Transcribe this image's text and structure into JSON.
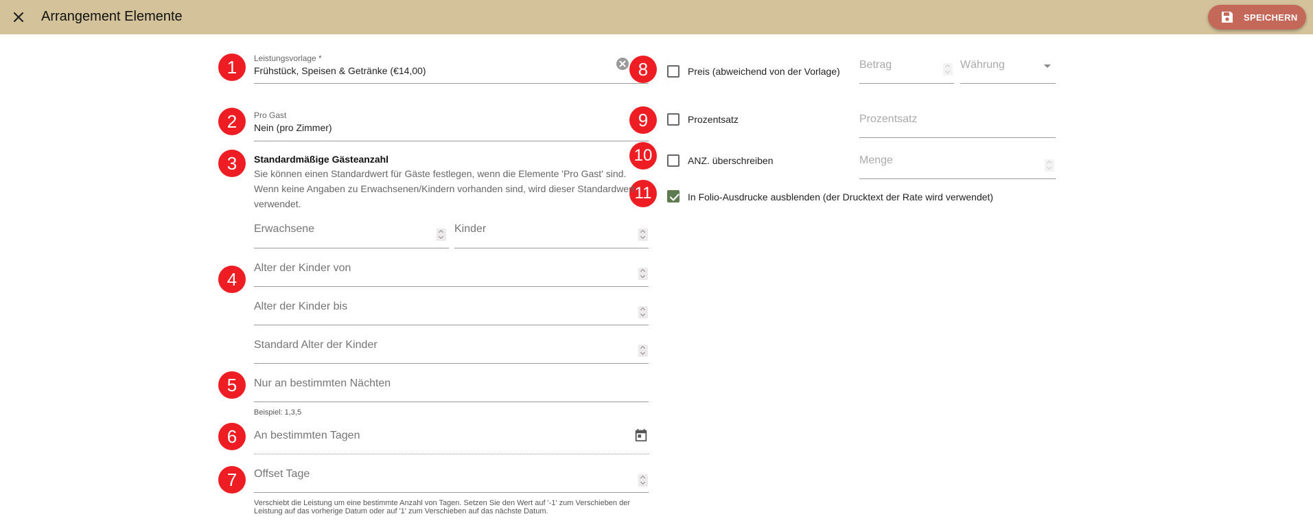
{
  "header": {
    "title": "Arrangement Elemente",
    "save_label": "SPEICHERN",
    "colors": {
      "bar": "#d3c29a",
      "save_button": "#c4685a",
      "badge": "#ee1d23"
    }
  },
  "badges": [
    "1",
    "2",
    "3",
    "4",
    "5",
    "6",
    "7",
    "8",
    "9",
    "10",
    "11"
  ],
  "left": {
    "leistungsvorlage": {
      "label": "Leistungsvorlage *",
      "value": "Frühstück, Speisen & Getränke (€14,00)"
    },
    "pro_gast": {
      "label": "Pro Gast",
      "value": "Nein (pro Zimmer)"
    },
    "standard_guests": {
      "title": "Standardmäßige Gästeanzahl",
      "description": "Sie können einen Standardwert für Gäste festlegen, wenn die Elemente 'Pro Gast' sind. Wenn keine Angaben zu Erwachsenen/Kindern vorhanden sind, wird dieser Standardwert verwendet.",
      "adults_placeholder": "Erwachsene",
      "children_placeholder": "Kinder"
    },
    "child_age_from": "Alter der Kinder von",
    "child_age_to": "Alter der Kinder bis",
    "child_age_default": "Standard Alter der Kinder",
    "nights": {
      "placeholder": "Nur an bestimmten Nächten",
      "hint": "Beispiel: 1,3,5"
    },
    "days": {
      "placeholder": "An bestimmten Tagen"
    },
    "offset": {
      "placeholder": "Offset Tage",
      "hint": "Verschiebt die Leistung um eine bestimmte Anzahl von Tagen. Setzen Sie den Wert auf '-1' zum Verschieben der Leistung auf das vorherige Datum oder auf '1' zum Verschieben auf das nächste Datum."
    }
  },
  "right": {
    "price": {
      "label": "Preis (abweichend von der Vorlage)",
      "checked": false,
      "amount_placeholder": "Betrag",
      "currency_placeholder": "Währung"
    },
    "percent": {
      "label": "Prozentsatz",
      "checked": false,
      "placeholder": "Prozentsatz"
    },
    "quantity": {
      "label": "ANZ. überschreiben",
      "checked": false,
      "placeholder": "Menge"
    },
    "hide_folio": {
      "label": "In Folio-Ausdrucke ausblenden (der Drucktext der Rate wird verwendet)",
      "checked": true
    }
  },
  "icons": [
    "close-icon",
    "save-icon",
    "clear-icon",
    "calendar-icon",
    "spinner-icon",
    "dropdown-arrow-icon",
    "checkmark-icon"
  ]
}
